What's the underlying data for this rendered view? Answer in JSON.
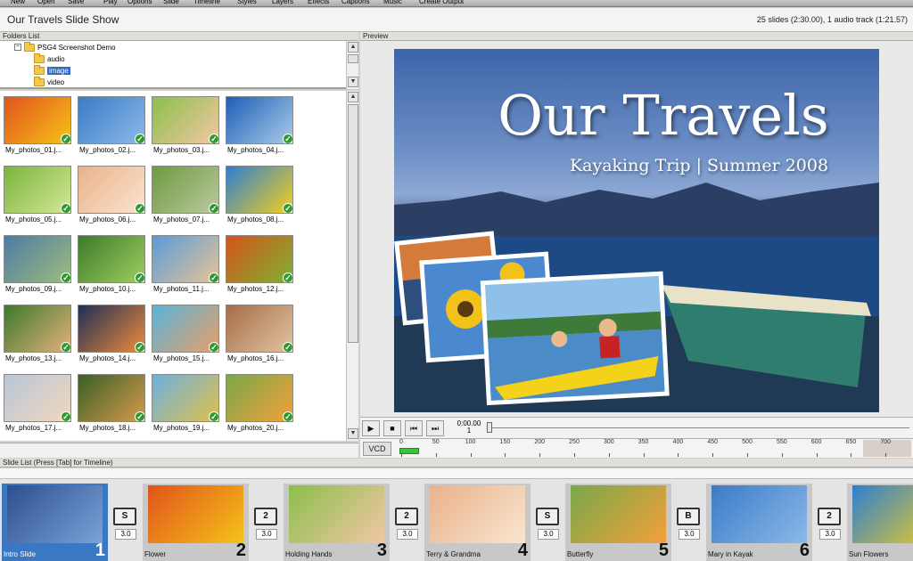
{
  "menu": [
    "New",
    "Open",
    "Save",
    "Play",
    "Options",
    "Slide",
    "Timeline",
    "Styles",
    "Layers",
    "Effects",
    "Captions",
    "Music",
    "Create Output"
  ],
  "show": {
    "title": "Our Travels Slide Show",
    "info": "25 slides (2:30.00), 1 audio track (1:21.57)"
  },
  "folders": {
    "header": "Folders List",
    "root": "PSG4 Screenshot Demo",
    "root_toggle": "−",
    "children": [
      "audio",
      "image",
      "video"
    ],
    "selected": "image"
  },
  "photos": [
    "My_photos_01.j...",
    "My_photos_02.j...",
    "My_photos_03.j...",
    "My_photos_04.j...",
    "My_photos_05.j...",
    "My_photos_06.j...",
    "My_photos_07.j...",
    "My_photos_08.j...",
    "My_photos_09.j...",
    "My_photos_10.j...",
    "My_photos_11.j...",
    "My_photos_12.j...",
    "My_photos_13.j...",
    "My_photos_14.j...",
    "My_photos_15.j...",
    "My_photos_16.j...",
    "My_photos_17.j...",
    "My_photos_18.j...",
    "My_photos_19.j...",
    "My_photos_20.j..."
  ],
  "photo_colors": [
    [
      "#e0541b",
      "#f6c21a"
    ],
    [
      "#3b7bc8",
      "#8cb9e8"
    ],
    [
      "#8bbf4a",
      "#f2c7a4"
    ],
    [
      "#1d5fb4",
      "#aacbea"
    ],
    [
      "#7ab53a",
      "#d6e79a"
    ],
    [
      "#e9b28b",
      "#f9e5cf"
    ],
    [
      "#6c9a3e",
      "#bcc9a1"
    ],
    [
      "#2d7fd1",
      "#f4cf1e"
    ],
    [
      "#4d7ba6",
      "#9dbd7b"
    ],
    [
      "#3c7a2c",
      "#9ecf5e"
    ],
    [
      "#5a9ad9",
      "#e6c596"
    ],
    [
      "#d4531a",
      "#7fb232"
    ],
    [
      "#3b7a2a",
      "#e3b07c"
    ],
    [
      "#1e2f55",
      "#f08a3b"
    ],
    [
      "#58b4d9",
      "#e89f6a"
    ],
    [
      "#a56d48",
      "#e2c4a2"
    ],
    [
      "#b8c6d8",
      "#f1d7bd"
    ],
    [
      "#3b5f27",
      "#d49a4a"
    ],
    [
      "#6cb0e0",
      "#e0c04a"
    ],
    [
      "#7aa84a",
      "#f2a03a"
    ]
  ],
  "preview": {
    "header": "Preview",
    "title": "Our Travels",
    "subtitle": "Kayaking Trip | Summer 2008"
  },
  "transport": {
    "time": "0:00.00",
    "frame": "1",
    "format": "VCD",
    "ticks": [
      "0",
      "50",
      "100",
      "150",
      "200",
      "250",
      "300",
      "350",
      "400",
      "450",
      "500",
      "550",
      "600",
      "650",
      "700"
    ]
  },
  "slidelist": {
    "header": "Slide List (Press [Tab] for Timeline)",
    "slides": [
      {
        "name": "Intro Slide",
        "num": "1",
        "c1": "#2c4f8f",
        "c2": "#7aa3d8"
      },
      {
        "name": "Flower",
        "num": "2",
        "c1": "#e0541b",
        "c2": "#f6c21a"
      },
      {
        "name": "Holding Hands",
        "num": "3",
        "c1": "#8bbf4a",
        "c2": "#f2c7a4"
      },
      {
        "name": "Terry & Grandma",
        "num": "4",
        "c1": "#e9b28b",
        "c2": "#f9e5cf"
      },
      {
        "name": "Butterfly",
        "num": "5",
        "c1": "#7aa84a",
        "c2": "#f2a03a"
      },
      {
        "name": "Mary in Kayak",
        "num": "6",
        "c1": "#3b7bc8",
        "c2": "#8cb9e8"
      },
      {
        "name": "Sun Flowers",
        "num": "",
        "c1": "#2d7fd1",
        "c2": "#f4cf1e"
      }
    ],
    "transitions": [
      {
        "icon": "S",
        "duration": "3.0"
      },
      {
        "icon": "2",
        "duration": "3.0"
      },
      {
        "icon": "2",
        "duration": "3.0"
      },
      {
        "icon": "S",
        "duration": "3.0"
      },
      {
        "icon": "B",
        "duration": "3.0"
      },
      {
        "icon": "2",
        "duration": "3.0"
      }
    ]
  }
}
